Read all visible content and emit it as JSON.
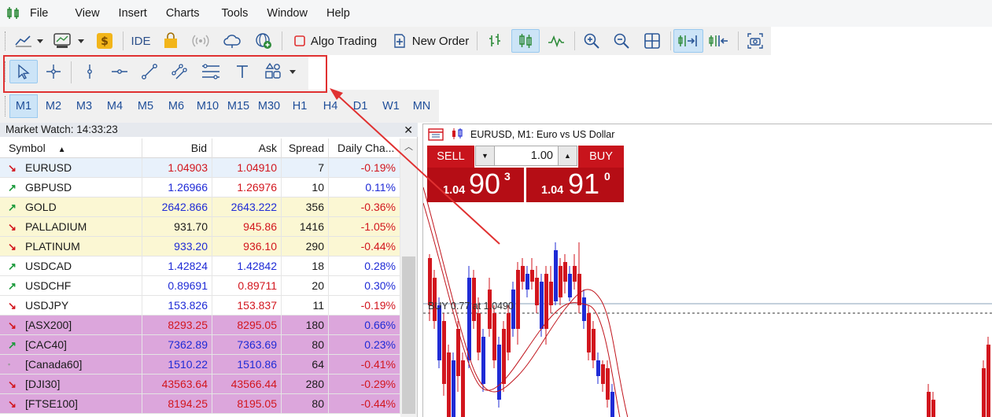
{
  "menu": [
    "File",
    "View",
    "Insert",
    "Charts",
    "Tools",
    "Window",
    "Help"
  ],
  "toolbar": {
    "algo_trading": "Algo Trading",
    "new_order": "New Order",
    "ide": "IDE"
  },
  "drawing_tools": [
    "cursor-icon",
    "crosshair-icon",
    "vertical-line-icon",
    "horizontal-line-icon",
    "trend-line-icon",
    "equidistant-channel-icon",
    "fibonacci-icon",
    "text-icon",
    "shapes-icon"
  ],
  "timeframes": [
    "M1",
    "M2",
    "M3",
    "M4",
    "M5",
    "M6",
    "M10",
    "M15",
    "M30",
    "H1",
    "H4",
    "D1",
    "W1",
    "MN"
  ],
  "active_timeframe": "M1",
  "market_watch": {
    "title": "Market Watch: 14:33:23",
    "columns": [
      "Symbol",
      "Bid",
      "Ask",
      "Spread",
      "Daily Cha..."
    ],
    "rows": [
      {
        "dir": "down",
        "symbol": "EURUSD",
        "bid": "1.04903",
        "ask": "1.04910",
        "spread": "7",
        "change": "-0.19%",
        "bg": "#e8f1fb",
        "bid_color": "#d2161e",
        "ask_color": "#d2161e"
      },
      {
        "dir": "up",
        "symbol": "GBPUSD",
        "bid": "1.26966",
        "ask": "1.26976",
        "spread": "10",
        "change": "0.11%",
        "bg": "#ffffff",
        "bid_color": "#1f2bd6",
        "ask_color": "#d2161e"
      },
      {
        "dir": "up",
        "symbol": "GOLD",
        "bid": "2642.866",
        "ask": "2643.222",
        "spread": "356",
        "change": "-0.36%",
        "bg": "#fbf7d3",
        "bid_color": "#1f2bd6",
        "ask_color": "#1f2bd6"
      },
      {
        "dir": "down",
        "symbol": "PALLADIUM",
        "bid": "931.70",
        "ask": "945.86",
        "spread": "1416",
        "change": "-1.05%",
        "bg": "#fbf7d3",
        "bid_color": "#1a1a1a",
        "ask_color": "#d2161e"
      },
      {
        "dir": "down",
        "symbol": "PLATINUM",
        "bid": "933.20",
        "ask": "936.10",
        "spread": "290",
        "change": "-0.44%",
        "bg": "#fbf7d3",
        "bid_color": "#1f2bd6",
        "ask_color": "#d2161e"
      },
      {
        "dir": "up",
        "symbol": "USDCAD",
        "bid": "1.42824",
        "ask": "1.42842",
        "spread": "18",
        "change": "0.28%",
        "bg": "#ffffff",
        "bid_color": "#1f2bd6",
        "ask_color": "#1f2bd6"
      },
      {
        "dir": "up",
        "symbol": "USDCHF",
        "bid": "0.89691",
        "ask": "0.89711",
        "spread": "20",
        "change": "0.30%",
        "bg": "#ffffff",
        "bid_color": "#1f2bd6",
        "ask_color": "#d2161e"
      },
      {
        "dir": "down",
        "symbol": "USDJPY",
        "bid": "153.826",
        "ask": "153.837",
        "spread": "11",
        "change": "-0.19%",
        "bg": "#ffffff",
        "bid_color": "#1f2bd6",
        "ask_color": "#d2161e"
      },
      {
        "dir": "down",
        "symbol": "[ASX200]",
        "bid": "8293.25",
        "ask": "8295.05",
        "spread": "180",
        "change": "0.66%",
        "bg": "#dca6dc",
        "bid_color": "#d2161e",
        "ask_color": "#d2161e"
      },
      {
        "dir": "up",
        "symbol": "[CAC40]",
        "bid": "7362.89",
        "ask": "7363.69",
        "spread": "80",
        "change": "0.23%",
        "bg": "#dca6dc",
        "bid_color": "#1f2bd6",
        "ask_color": "#1f2bd6"
      },
      {
        "dir": "flat",
        "symbol": "[Canada60]",
        "bid": "1510.22",
        "ask": "1510.86",
        "spread": "64",
        "change": "-0.41%",
        "bg": "#dca6dc",
        "bid_color": "#1f2bd6",
        "ask_color": "#1f2bd6"
      },
      {
        "dir": "down",
        "symbol": "[DJI30]",
        "bid": "43563.64",
        "ask": "43566.44",
        "spread": "280",
        "change": "-0.29%",
        "bg": "#dca6dc",
        "bid_color": "#d2161e",
        "ask_color": "#d2161e"
      },
      {
        "dir": "down",
        "symbol": "[FTSE100]",
        "bid": "8194.25",
        "ask": "8195.05",
        "spread": "80",
        "change": "-0.44%",
        "bg": "#dca6dc",
        "bid_color": "#d2161e",
        "ask_color": "#d2161e"
      }
    ]
  },
  "chart": {
    "title": "EURUSD, M1:  Euro vs US Dollar",
    "sell_label": "SELL",
    "buy_label": "BUY",
    "lot": "1.00",
    "sell_price_prefix": "1.04",
    "sell_price_big": "90",
    "sell_price_sup": "3",
    "buy_price_prefix": "1.04",
    "buy_price_big": "91",
    "buy_price_sup": "0",
    "order_line_label": "BUY 0.77 at 1.0490"
  },
  "colors": {
    "up_arrow": "#1a9a3a",
    "down_arrow": "#d2161e",
    "flat_dot": "#9a9a9a",
    "bull_candle": "#1f2bd6",
    "bear_candle": "#d2161e",
    "annotation": "#e03131"
  }
}
